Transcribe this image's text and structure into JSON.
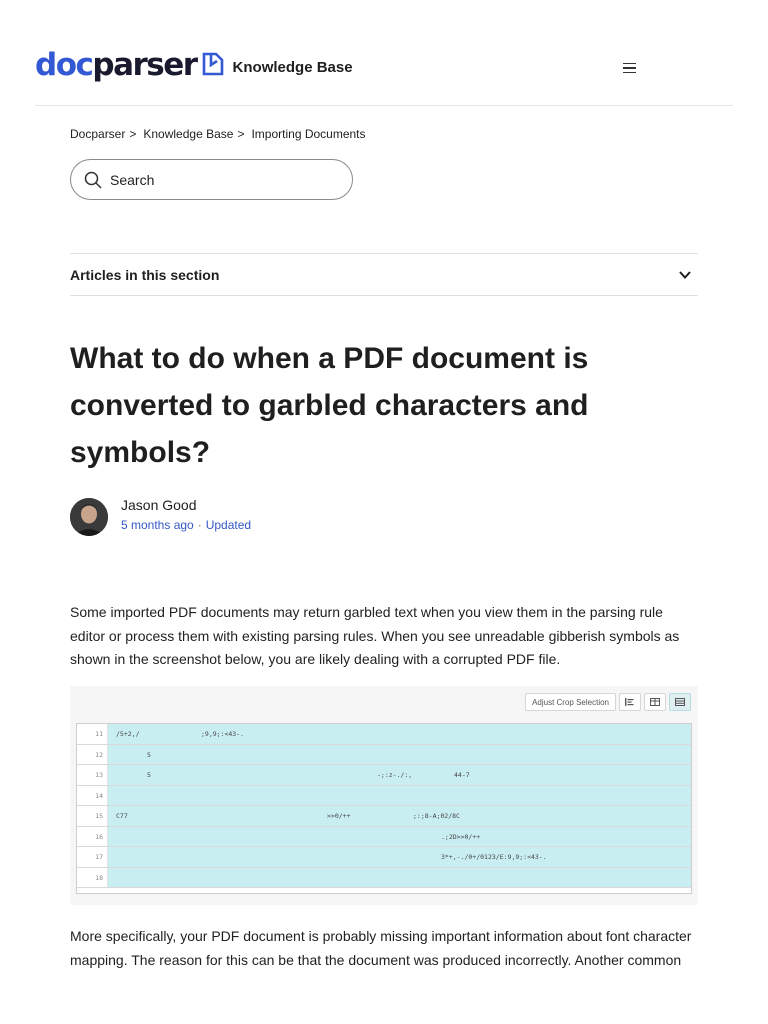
{
  "header": {
    "logo_doc": "doc",
    "logo_parser": "parser",
    "knowledge_base": "Knowledge Base"
  },
  "breadcrumb": [
    "Docparser",
    "Knowledge Base",
    "Importing Documents"
  ],
  "breadcrumb_sep": ">",
  "search": {
    "placeholder": "Search"
  },
  "section_toggle": {
    "label": "Articles in this section"
  },
  "article": {
    "title": "What to do when a PDF document is converted to garbled characters and symbols?",
    "author_name": "Jason Good",
    "time_ago": "5 months ago",
    "updated": "Updated",
    "paragraph1": "Some imported PDF documents may return garbled text when you view them in the parsing rule editor or process them with existing parsing rules. When you see unreadable gibberish symbols as shown in the screenshot below, you are likely dealing with a corrupted PDF file.",
    "paragraph2": "More specifically, your PDF document is probably missing important information about font character mapping. The reason for this can be that the document was produced incorrectly. Another common"
  },
  "screenshot": {
    "adjust_crop": "Adjust Crop Selection",
    "rows": [
      {
        "num": "11",
        "cells": [
          "/5+2,/",
          ";9,9;:<43-."
        ]
      },
      {
        "num": "12",
        "cells": [
          "5"
        ]
      },
      {
        "num": "13",
        "cells": [
          "5",
          "-;:z-./:,",
          "44-7"
        ]
      },
      {
        "num": "14",
        "cells": []
      },
      {
        "num": "15",
        "cells": [
          "C77",
          ">>0/++",
          ";:;8-A;02/8C"
        ]
      },
      {
        "num": "16",
        "cells": [
          ".;2D>>0/++"
        ]
      },
      {
        "num": "17",
        "cells": [
          "3*+,-./0+/0123/E:9,9;:<43-."
        ]
      },
      {
        "num": "18",
        "cells": []
      }
    ]
  },
  "colors": {
    "brand_blue": "#3358d4",
    "link_blue": "#3558c7",
    "cell_highlight": "#c9eef2"
  }
}
